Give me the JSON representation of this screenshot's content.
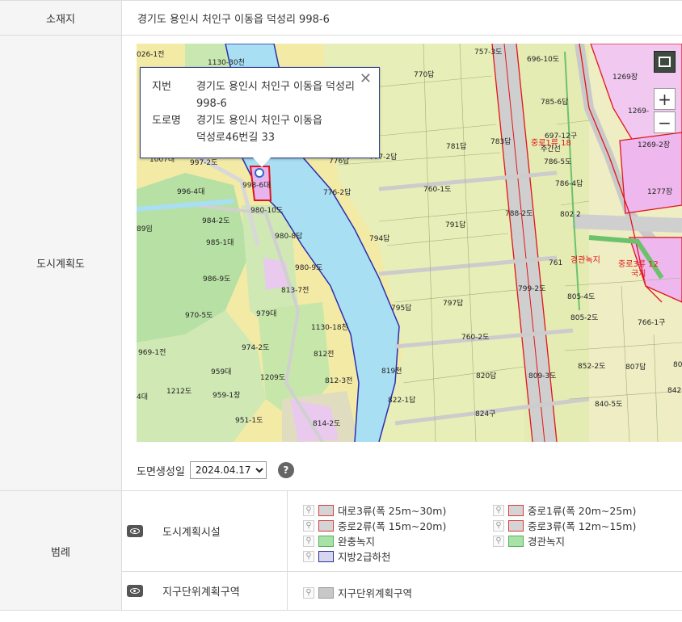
{
  "location": {
    "label": "소재지",
    "value": "경기도 용인시 처인구 이동읍 덕성리 998-6"
  },
  "plan": {
    "label": "도시계획도",
    "popup": {
      "jibun_label": "지번",
      "jibun_value_line1": "경기도 용인시 처인구 이동읍 덕성리",
      "jibun_value_line2": "998-6",
      "road_label": "도로명",
      "road_value_line1": "경기도 용인시 처인구 이동읍",
      "road_value_line2": "덕성로46번길 33",
      "close_glyph": "✕"
    },
    "zoom_in": "+",
    "zoom_out": "−",
    "parcel_labels": [
      "026-1전",
      "1130-30천",
      "757-3도",
      "696-10도",
      "770답",
      "1269장",
      "785-6답",
      "1269-",
      "697-12구",
      "783답",
      "781답",
      "1269-2장",
      "777-2답",
      "776답",
      "786-5도",
      "997-2도",
      "998-6대",
      "776-2답",
      "760-1도",
      "786-4답",
      "1277장",
      "996-4대",
      "980-10도",
      "788-2도",
      "802",
      "984-2도",
      "791답",
      "89임",
      "980-8답",
      "794답",
      "985-1대",
      "761",
      "980-9도",
      "986-9도",
      "813-7전",
      "799-2도",
      "979대",
      "797답",
      "795답",
      "805-4도",
      "970-5도",
      "805-2도",
      "766-1구",
      "1130-18천",
      "760-2도",
      "974-2도",
      "812전",
      "969-1전",
      "852-2도",
      "807답",
      "80",
      "959대",
      "820답",
      "809-3도",
      "819천",
      "1209도",
      "812-3전",
      "4대",
      "1212도",
      "959-1창",
      "822-1답",
      "840-5도",
      "842",
      "824구",
      "951-1도",
      "814-2도",
      "1007대",
      "2",
      "주간선"
    ],
    "red_labels": [
      "중로1류 18",
      "경관녹지",
      "중로3류 12",
      "국지"
    ],
    "date_label": "도면생성일",
    "date_value": "2024.04.17",
    "help": "?"
  },
  "legend": {
    "label": "범례",
    "groups": [
      {
        "name": "도시계획시설",
        "items": [
          {
            "label": "대로3류(폭 25m~30m)",
            "fill": "#d4d4d4",
            "border": "#d93b3b"
          },
          {
            "label": "중로1류(폭 20m~25m)",
            "fill": "#d4d4d4",
            "border": "#d93b3b"
          },
          {
            "label": "중로2류(폭 15m~20m)",
            "fill": "#d4d4d4",
            "border": "#d93b3b"
          },
          {
            "label": "중로3류(폭 12m~15m)",
            "fill": "#d4d4d4",
            "border": "#d93b3b"
          },
          {
            "label": "완충녹지",
            "fill": "#a9e2a9",
            "border": "#55b055"
          },
          {
            "label": "경관녹지",
            "fill": "#a9e2a9",
            "border": "#55b055"
          },
          {
            "label": "지방2급하천",
            "fill": "#d6d6ef",
            "border": "#2d2d9c"
          }
        ]
      },
      {
        "name": "지구단위계획구역",
        "items": [
          {
            "label": "지구단위계획구역",
            "fill": "#c8c8c8",
            "border": "#999999"
          }
        ]
      }
    ]
  }
}
